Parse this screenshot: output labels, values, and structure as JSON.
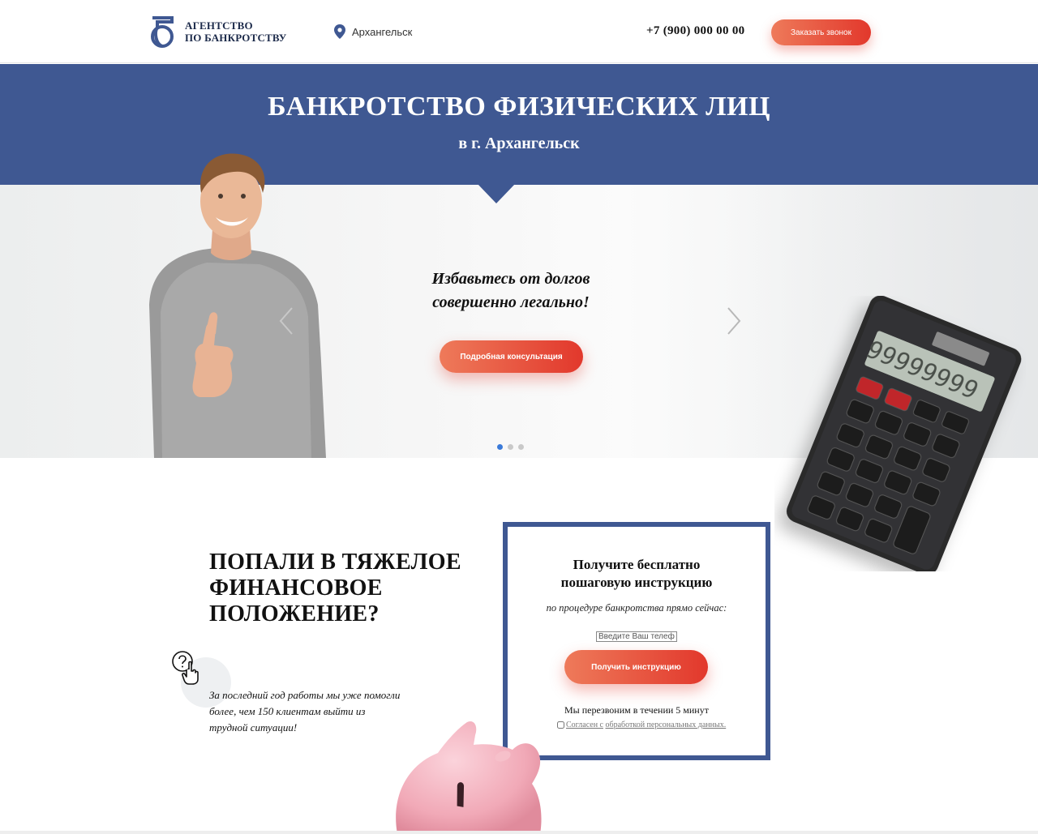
{
  "header": {
    "logo_line1": "АГЕНТСТВО",
    "logo_line2": "ПО БАНКРОТСТВУ",
    "logo_letter": "Б",
    "city": "Архангельск",
    "phone": "+7 (900) 000 00 00",
    "callback_label": "Заказать звонок"
  },
  "hero": {
    "title": "БАНКРОТСТВО ФИЗИЧЕСКИХ ЛИЦ",
    "subtitle": "в г. Архангельск"
  },
  "slider": {
    "line1": "Избавьтесь от долгов",
    "line2": "совершенно легально!",
    "button_label": "Подробная консультация",
    "calculator_display": "99999999",
    "active_slide": 1,
    "slide_count": 3
  },
  "problem": {
    "heading_line1": "ПОПАЛИ В ТЯЖЕЛОЕ",
    "heading_line2": "ФИНАНСОВОЕ",
    "heading_line3": "ПОЛОЖЕНИЕ?",
    "stat_line1": "За последний год работы мы уже помогли",
    "stat_line2": "более, чем 150 клиентам выйти из",
    "stat_line3": "трудной ситуации!"
  },
  "form": {
    "title_line1": "Получите бесплатно",
    "title_line2": "пошаговую инструкцию",
    "subtitle": "по процедуре банкротства прямо сейчас:",
    "phone_placeholder": "Введите Ваш телефон",
    "button_label": "Получить инструкцию",
    "note": "Мы перезвоним в течении 5 минут",
    "consent_part1": "Согласен с",
    "consent_part2": "обработкой персональных данных."
  },
  "colors": {
    "brand_blue": "#3f5892",
    "accent_start": "#ee7a5a",
    "accent_end": "#e2382c",
    "active_dot": "#3a7ad9"
  },
  "icons": [
    "logo-b-icon",
    "location-pin-icon",
    "chevron-left-icon",
    "chevron-right-icon",
    "question-hand-icon"
  ]
}
